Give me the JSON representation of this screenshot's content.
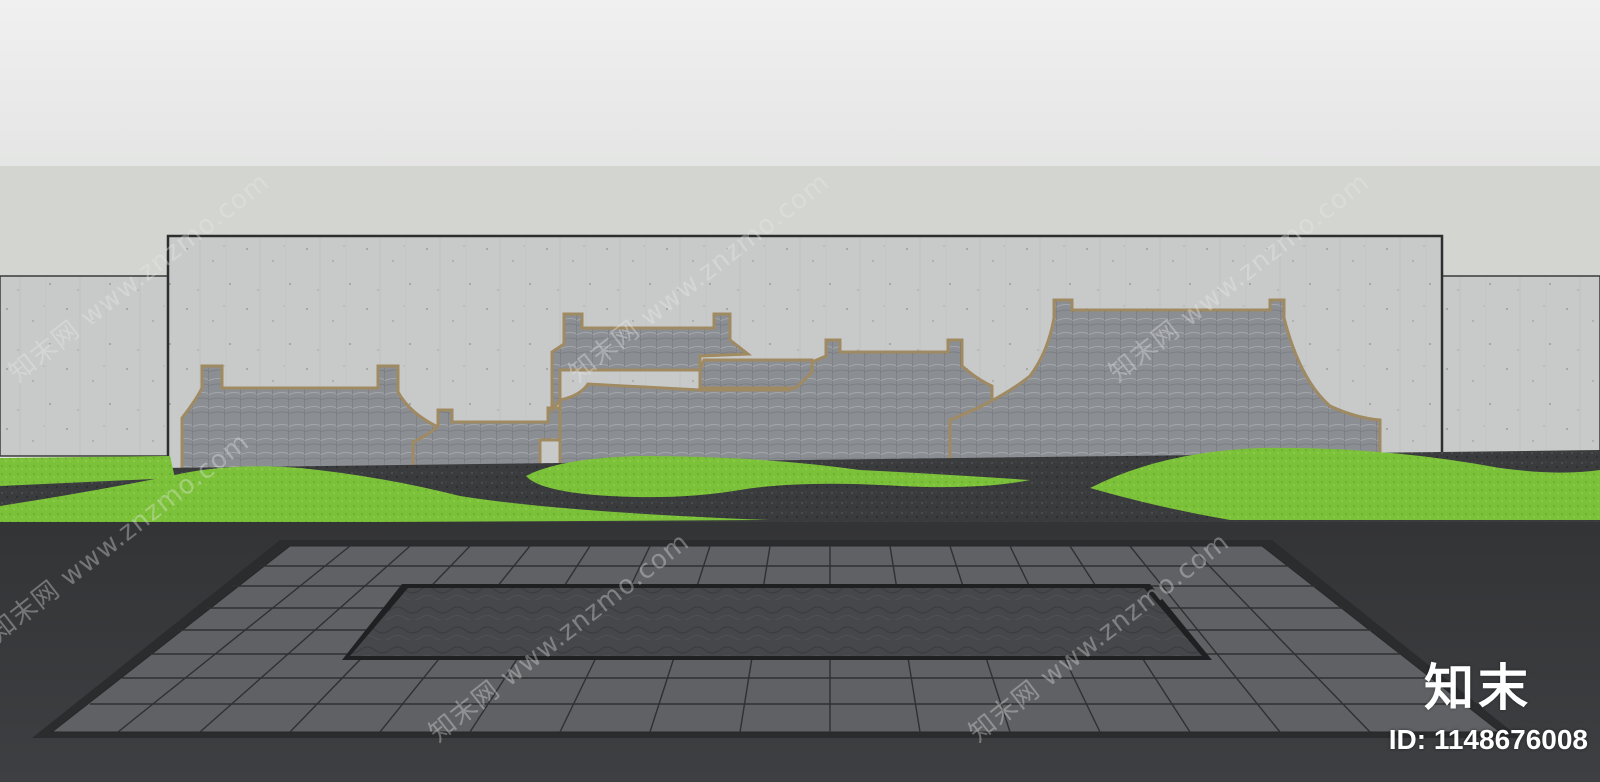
{
  "scene": {
    "subject": "landscape feature wall with stylized roofline relief panels, lawn mounds, gravel bed and paved plaza",
    "colors": {
      "sky_top": "#ececec",
      "sky_band": "#d4d6d2",
      "wall_concrete": "#c9cbcb",
      "relief_panel": "#8a8d92",
      "metal_trim": "#a08a62",
      "lawn": "#7ec23a",
      "gravel": "#3a3b3d",
      "plaza_ground": "#3b3c3e",
      "paving": "#5e6064",
      "inner_pool": "#434547"
    }
  },
  "watermarks": {
    "text": "知末网 www.znzmo.com"
  },
  "brand": {
    "logo_text": "知末",
    "id_text": "ID: 1148676008"
  }
}
